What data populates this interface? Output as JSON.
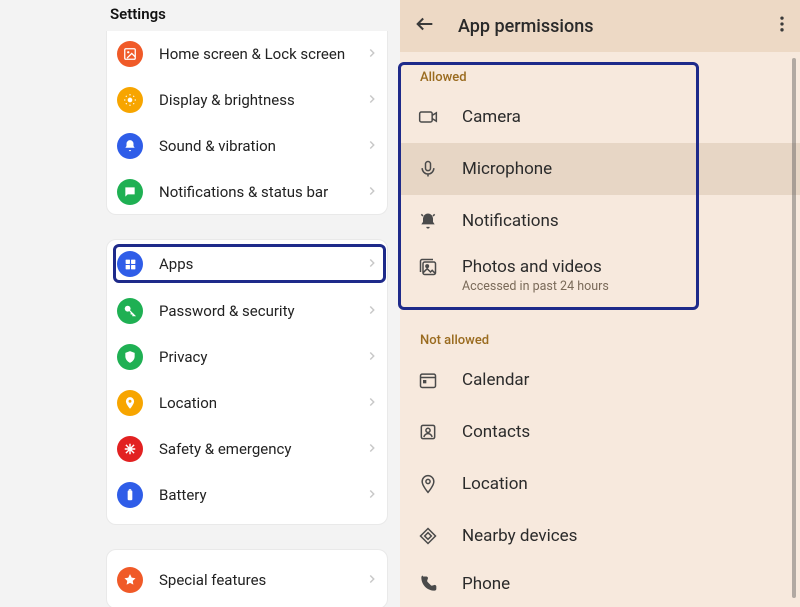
{
  "settings": {
    "title": "Settings",
    "group1": [
      {
        "id": "home-lock",
        "label": "Home screen & Lock screen",
        "bg": "#f05a28",
        "icon": "image"
      },
      {
        "id": "display-brightness",
        "label": "Display & brightness",
        "bg": "#f7a500",
        "icon": "sun"
      },
      {
        "id": "sound-vibration",
        "label": "Sound & vibration",
        "bg": "#2f5de8",
        "icon": "bell"
      },
      {
        "id": "notifications-status",
        "label": "Notifications & status bar",
        "bg": "#1fb053",
        "icon": "message"
      }
    ],
    "group2": [
      {
        "id": "apps",
        "label": "Apps",
        "bg": "#2f5de8",
        "icon": "grid"
      },
      {
        "id": "password-security",
        "label": "Password & security",
        "bg": "#1fb053",
        "icon": "key"
      },
      {
        "id": "privacy",
        "label": "Privacy",
        "bg": "#1fb053",
        "icon": "shield"
      },
      {
        "id": "location",
        "label": "Location",
        "bg": "#f7a500",
        "icon": "pin"
      },
      {
        "id": "safety-emergency",
        "label": "Safety & emergency",
        "bg": "#e22121",
        "icon": "asterisk"
      },
      {
        "id": "battery",
        "label": "Battery",
        "bg": "#2f5de8",
        "icon": "battery"
      }
    ],
    "group3": [
      {
        "id": "special-features",
        "label": "Special features",
        "bg": "#f05a28",
        "icon": "star"
      }
    ]
  },
  "permissions": {
    "title": "App permissions",
    "allowed_label": "Allowed",
    "not_allowed_label": "Not allowed",
    "allowed": [
      {
        "id": "camera",
        "label": "Camera",
        "icon": "camera"
      },
      {
        "id": "microphone",
        "label": "Microphone",
        "icon": "mic",
        "selected": true
      },
      {
        "id": "notifications",
        "label": "Notifications",
        "icon": "bell-solid"
      },
      {
        "id": "photos-videos",
        "label": "Photos and videos",
        "icon": "gallery",
        "sub": "Accessed in past 24 hours"
      }
    ],
    "not_allowed": [
      {
        "id": "calendar",
        "label": "Calendar",
        "icon": "calendar"
      },
      {
        "id": "contacts",
        "label": "Contacts",
        "icon": "contacts"
      },
      {
        "id": "location",
        "label": "Location",
        "icon": "pin-outline"
      },
      {
        "id": "nearby",
        "label": "Nearby devices",
        "icon": "diamond"
      },
      {
        "id": "phone",
        "label": "Phone",
        "icon": "phone"
      }
    ]
  }
}
